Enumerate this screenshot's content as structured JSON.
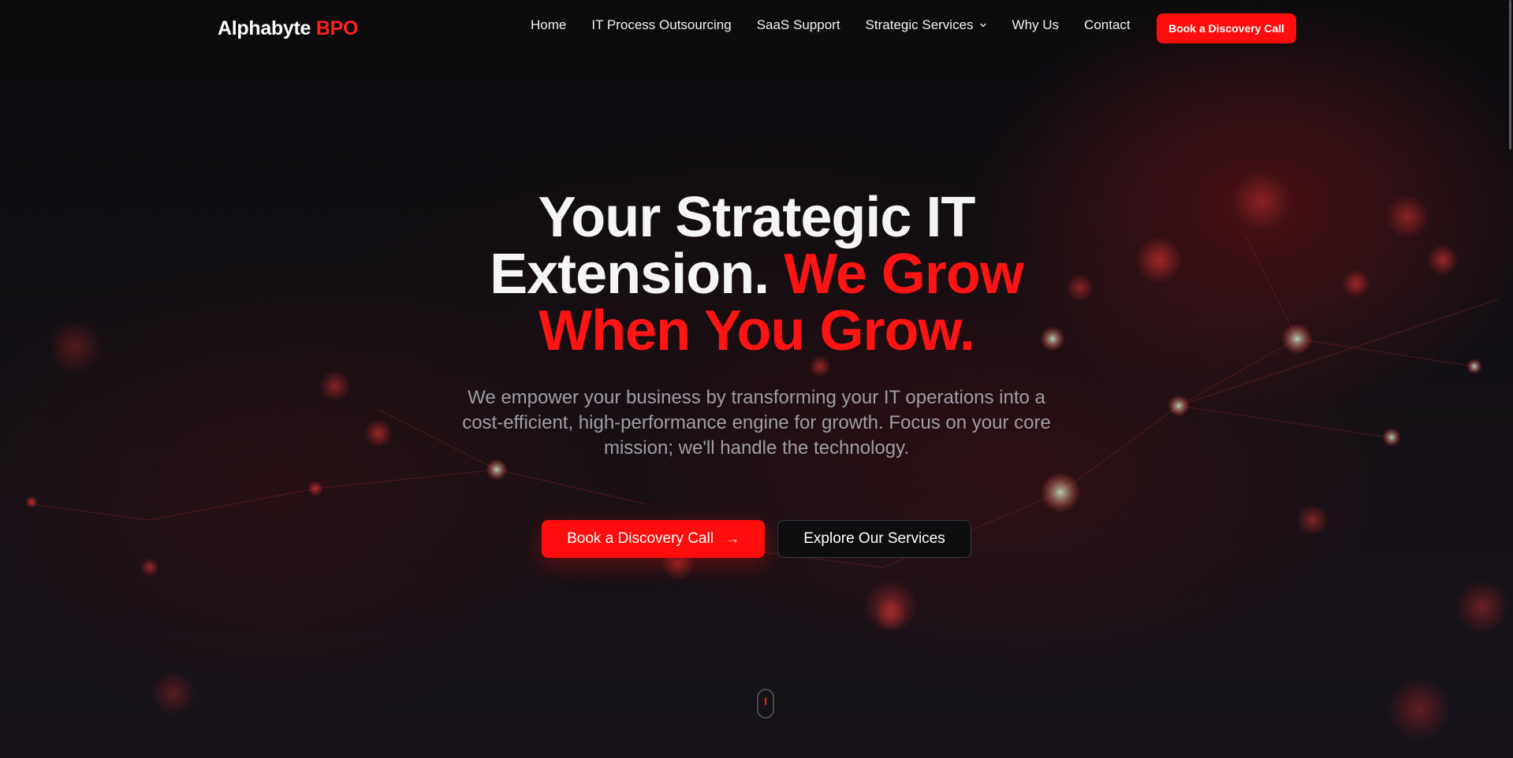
{
  "brand": {
    "name": "Alphabyte",
    "accent": "BPO",
    "accent_color": "#ff1f1f"
  },
  "nav": {
    "items": [
      {
        "label": "Home"
      },
      {
        "label": "IT Process Outsourcing"
      },
      {
        "label": "SaaS Support"
      },
      {
        "label": "Strategic Services",
        "icon": "chevron-down-icon"
      },
      {
        "label": "Why Us"
      },
      {
        "label": "Contact"
      }
    ],
    "cta_label": "Book a Discovery Call"
  },
  "hero": {
    "title_line1": "Your Strategic IT",
    "title_line2_white": "Extension.",
    "title_line2_red": "We Grow",
    "title_line3_red": "When You Grow.",
    "subtitle": "We empower your business by transforming your IT operations into a cost-efficient, high-performance engine for growth. Focus on your core mission; we'll handle the technology.",
    "primary_button": "Book a Discovery Call",
    "primary_icon": "arrow-right-icon",
    "secondary_button": "Explore Our Services"
  },
  "colors": {
    "brand_red": "#ff0d0d",
    "background": "#0d0d10",
    "subtitle_gray": "#9e9ea6"
  }
}
